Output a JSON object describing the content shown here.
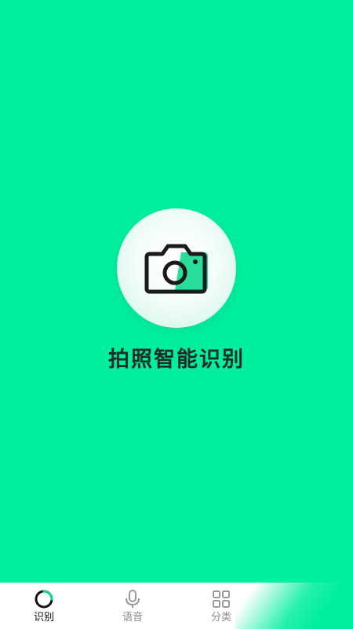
{
  "main": {
    "title": "拍照智能识别",
    "camera_icon": "camera-icon"
  },
  "tabbar": {
    "items": [
      {
        "label": "识别",
        "icon": "circle-ring-icon",
        "active": true
      },
      {
        "label": "语音",
        "icon": "microphone-icon",
        "active": false
      },
      {
        "label": "分类",
        "icon": "grid-icon",
        "active": false
      }
    ]
  },
  "colors": {
    "background": "#00EEA0",
    "accent": "#13D98F",
    "title_text": "#1F2D26",
    "tab_active_text": "#111111",
    "tab_inactive_text": "#8A8A8A",
    "tabbar_background": "#FFFFFF"
  }
}
